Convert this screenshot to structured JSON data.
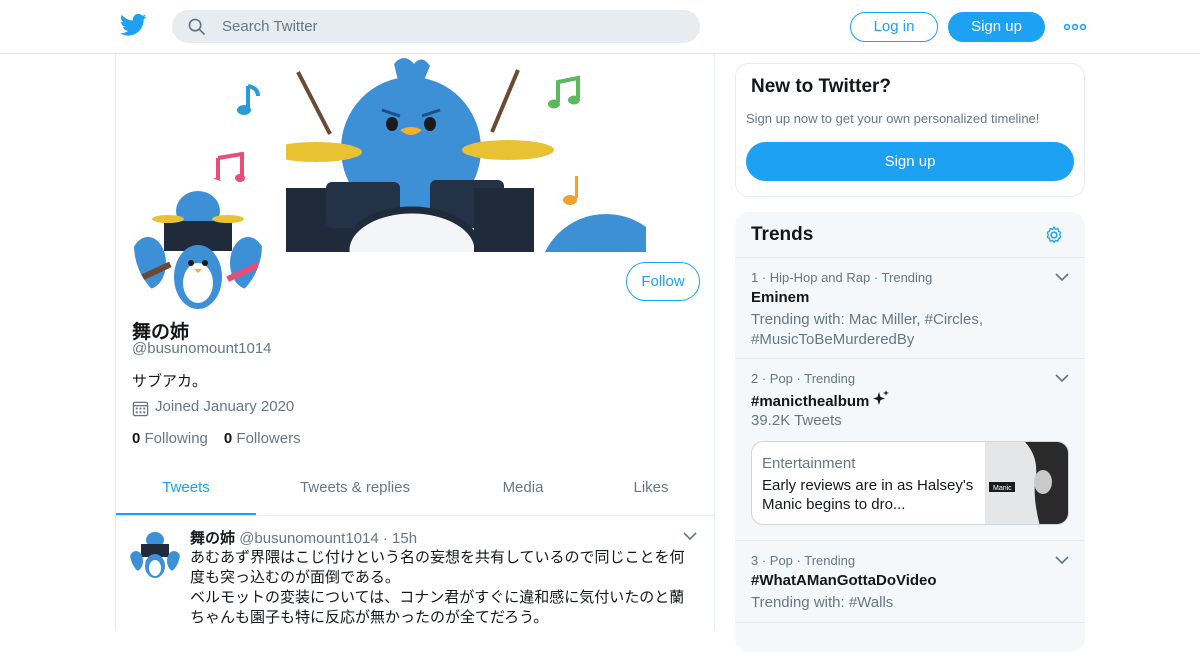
{
  "topbar": {
    "search_placeholder": "Search Twitter",
    "login_label": "Log in",
    "signup_label": "Sign up",
    "brand_color": "#1da1f2"
  },
  "profile": {
    "name": "舞の姉",
    "handle": "@busunomount1014",
    "bio": "サブアカ。",
    "joined": "Joined January 2020",
    "following_count": "0",
    "following_label": "Following",
    "followers_count": "0",
    "followers_label": "Followers",
    "follow_label": "Follow"
  },
  "tabs": [
    {
      "label": "Tweets",
      "active": true
    },
    {
      "label": "Tweets & replies",
      "active": false
    },
    {
      "label": "Media",
      "active": false
    },
    {
      "label": "Likes",
      "active": false
    }
  ],
  "tweet": {
    "name": "舞の姉",
    "handle": "@busunomount1014",
    "separator": "·",
    "time": "15h",
    "lines": [
      "あむあず界隈はこじ付けという名の妄想を共有しているので同じことを何",
      "度も突っ込むのが面倒である。",
      "ベルモットの変装については、コナン君がすぐに違和感に気付いたのと蘭",
      "ちゃんも園子も特に反応が無かったのが全てだろう。"
    ]
  },
  "new_card": {
    "title": "New to Twitter?",
    "text": "Sign up now to get your own personalized timeline!",
    "button": "Sign up"
  },
  "trends": {
    "title": "Trends",
    "items": [
      {
        "meta": "1 · Hip-Hop and Rap · Trending",
        "name": "Eminem",
        "sub": "Trending with: Mac Miller, #Circles, #MusicToBeMurderedBy"
      },
      {
        "meta": "2 · Pop · Trending",
        "name": "#manicthealbum",
        "sub": "39.2K Tweets",
        "news": {
          "category": "Entertainment",
          "headline": "Early reviews are in as Halsey's Manic begins to dro...",
          "thumb_text": "Manic"
        }
      },
      {
        "meta": "3 · Pop · Trending",
        "name": "#WhatAManGottaDoVideo",
        "sub": "Trending with: #Walls"
      }
    ]
  },
  "icons": [
    "twitter-bird-icon",
    "search-icon",
    "more-dots-icon",
    "calendar-icon",
    "chevron-down-icon",
    "gear-icon",
    "sparkle-icon"
  ]
}
